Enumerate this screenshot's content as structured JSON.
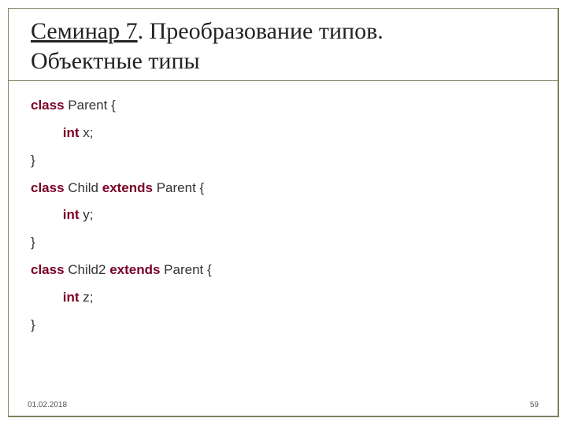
{
  "title": {
    "underlined": "Семинар 7",
    "rest_line1": ". Преобразование типов.",
    "line2": "Объектные типы"
  },
  "code": {
    "l1_kw": "class",
    "l1_rest": " Parent {",
    "l2_kw": "int",
    "l2_rest": " x;",
    "l3": "}",
    "l4_kw1": "class",
    "l4_mid": " Child ",
    "l4_kw2": "extends",
    "l4_rest": " Parent {",
    "l5_kw": "int",
    "l5_rest": " y;",
    "l6": "}",
    "l7_kw1": "class",
    "l7_mid": " Child2 ",
    "l7_kw2": "extends",
    "l7_rest": " Parent {",
    "l8_kw": "int",
    "l8_rest": " z;",
    "l9": "}"
  },
  "footer": {
    "date": "01.02.2018",
    "page": "59"
  }
}
